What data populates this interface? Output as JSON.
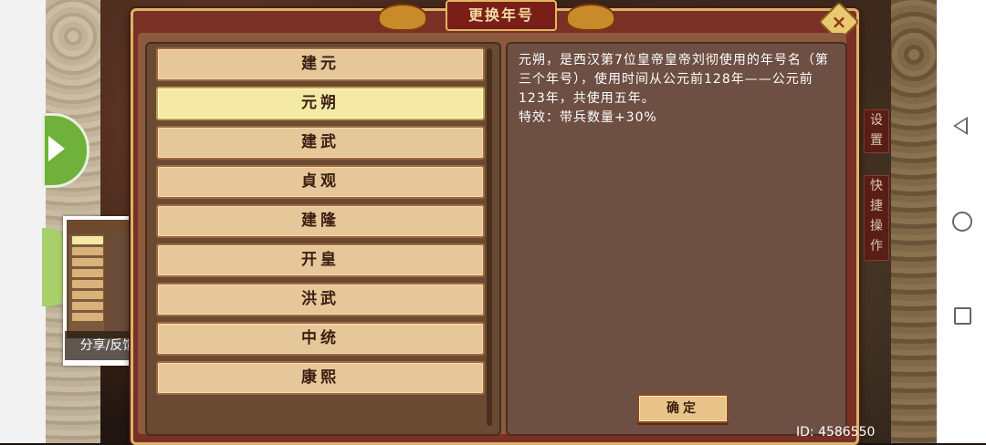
{
  "dialog": {
    "title": "更换年号",
    "close_icon": "×"
  },
  "era_list": [
    {
      "label": "建元",
      "selected": false
    },
    {
      "label": "元朔",
      "selected": true
    },
    {
      "label": "建武",
      "selected": false
    },
    {
      "label": "貞观",
      "selected": false
    },
    {
      "label": "建隆",
      "selected": false
    },
    {
      "label": "开皇",
      "selected": false
    },
    {
      "label": "洪武",
      "selected": false
    },
    {
      "label": "中统",
      "selected": false
    },
    {
      "label": "康熙",
      "selected": false
    }
  ],
  "description": {
    "text": "元朔，是西汉第7位皇帝皇帝刘彻使用的年号名（第三个年号），使用时间从公元前128年——公元前123年，共使用五年。",
    "effect": "特效：带兵数量+30%"
  },
  "confirm_label": "确定",
  "share": {
    "label": "分享/反馈"
  },
  "side_tabs": {
    "top": "设置",
    "bottom": "快捷操作"
  },
  "footer": {
    "id_text": "ID: 4586550"
  }
}
